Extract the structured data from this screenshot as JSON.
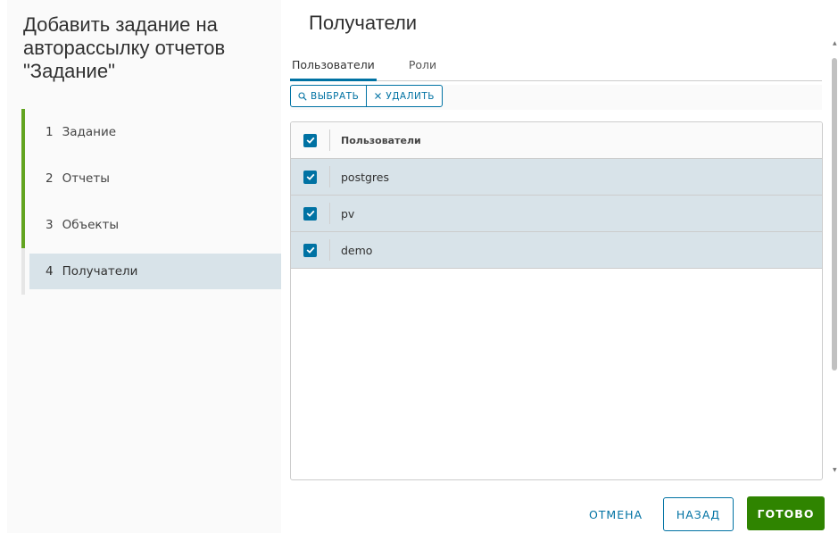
{
  "wizard": {
    "title": "Добавить задание на авторассылку отчетов \"Задание\"",
    "steps": [
      {
        "num": "1",
        "label": "Задание",
        "state": "done"
      },
      {
        "num": "2",
        "label": "Отчеты",
        "state": "done"
      },
      {
        "num": "3",
        "label": "Объекты",
        "state": "done"
      },
      {
        "num": "4",
        "label": "Получатели",
        "state": "active"
      }
    ]
  },
  "main": {
    "title": "Получатели",
    "tabs": [
      {
        "label": "Пользователи",
        "active": true
      },
      {
        "label": "Роли",
        "active": false
      }
    ],
    "toolbar": {
      "select_label": "ВЫБРАТЬ",
      "delete_label": "УДАЛИТЬ"
    },
    "grid": {
      "header": "Пользователи",
      "header_checked": true,
      "rows": [
        {
          "name": "postgres",
          "checked": true
        },
        {
          "name": "pv",
          "checked": true
        },
        {
          "name": "demo",
          "checked": true
        }
      ]
    }
  },
  "footer": {
    "cancel_label": "ОТМЕНА",
    "back_label": "НАЗАД",
    "done_label": "ГОТОВО"
  },
  "colors": {
    "accent": "#0072a3",
    "done_step": "#62a420",
    "selected_row": "#d8e3e9",
    "primary_button": "#2f8400"
  },
  "icons": {
    "select": "search-icon",
    "delete": "close-icon",
    "checkbox": "check-icon"
  }
}
